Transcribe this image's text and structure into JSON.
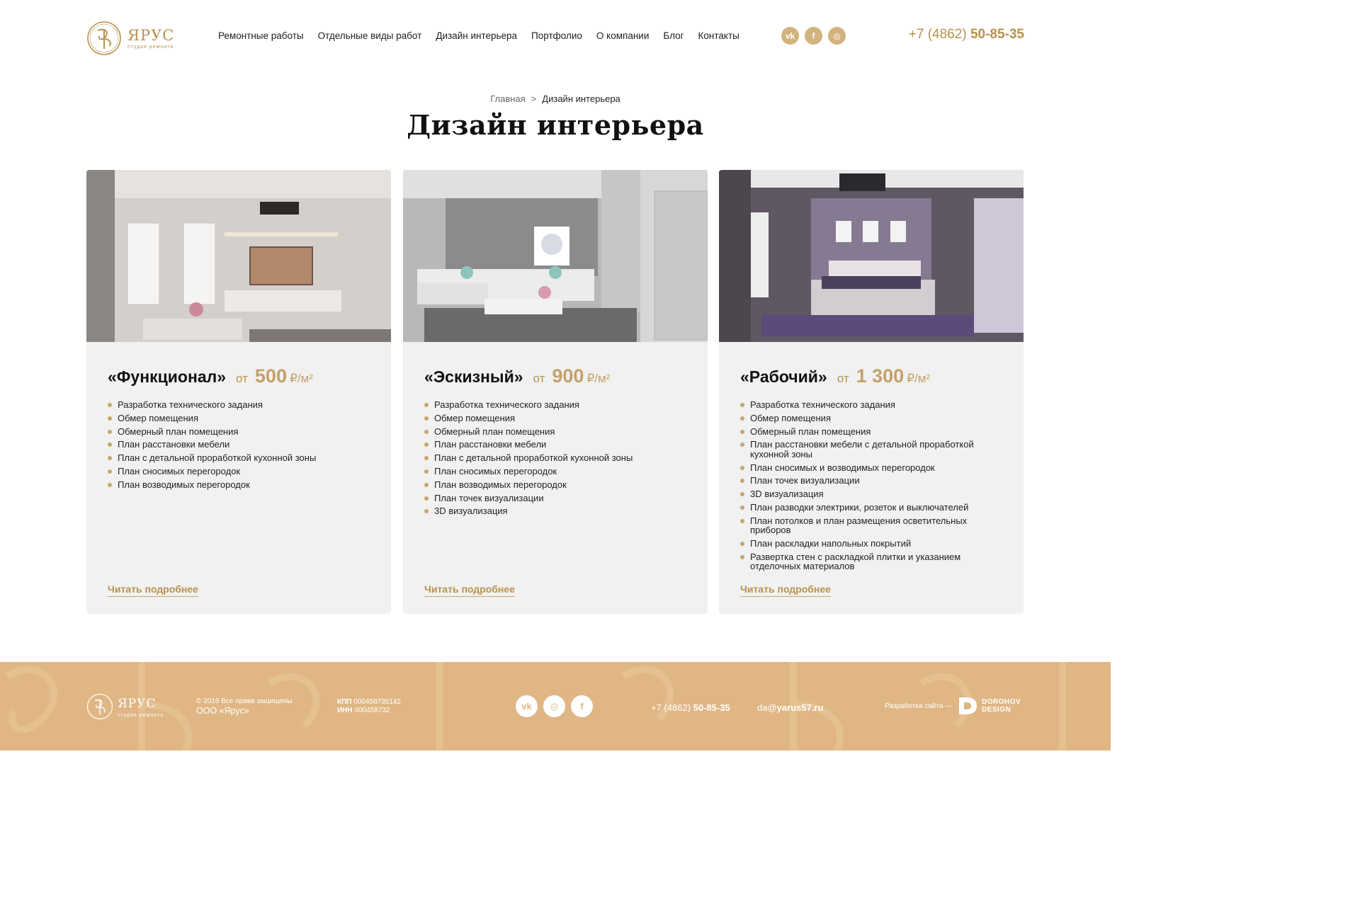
{
  "header": {
    "logo": {
      "name": "ЯРУС",
      "sub": "студия ремонта"
    },
    "nav": [
      {
        "label": "Ремонтные работы"
      },
      {
        "label": "Отдельные виды работ"
      },
      {
        "label": "Дизайн интерьера"
      },
      {
        "label": "Портфолио"
      },
      {
        "label": "О компании"
      },
      {
        "label": "Блог"
      },
      {
        "label": "Контакты"
      }
    ],
    "socials": [
      {
        "icon": "vk-icon",
        "glyph": "vk"
      },
      {
        "icon": "facebook-icon",
        "glyph": "f"
      },
      {
        "icon": "instagram-icon",
        "glyph": "◎"
      }
    ],
    "phone": {
      "prefix": "+7 (4862) ",
      "number": "50-85-35"
    }
  },
  "breadcrumb": {
    "home": "Главная",
    "separator": ">",
    "current": "Дизайн интерьера"
  },
  "title": "Дизайн интерьера",
  "cards": [
    {
      "name": "«Функционал»",
      "from": "от",
      "price": "500",
      "unit": "₽/м²",
      "items": [
        "Разработка технического задания",
        "Обмер помещения",
        "Обмерный план помещения",
        "План расстановки мебели",
        "План с детальной проработкой кухонной зоны",
        "План сносимых перегородок",
        "План возводимых перегородок"
      ],
      "more": "Читать подробнее"
    },
    {
      "name": "«Эскизный»",
      "from": "от",
      "price": "900",
      "unit": "₽/м²",
      "items": [
        "Разработка технического задания",
        "Обмер помещения",
        "Обмерный план помещения",
        "План расстановки мебели",
        "План с детальной проработкой кухонной зоны",
        "План сносимых перегородок",
        "План возводимых перегородок",
        "План точек визуализации",
        "3D визуализация"
      ],
      "more": "Читать подробнее"
    },
    {
      "name": "«Рабочий»",
      "from": "от",
      "price": "1 300",
      "unit": "₽/м²",
      "items": [
        "Разработка технического задания",
        "Обмер помещения",
        "Обмерный план помещения",
        "План расстановки мебели с детальной проработкой кухонной зоны",
        "План сносимых и возводимых перегородок",
        "План точек визуализации",
        "3D визуализация",
        "План разводки электрики, розеток и выключателей",
        "План потолков и план размещения осветительных приборов",
        "План раскладки напольных покрытий",
        "Развертка стен с раскладкой плитки и указанием отделочных материалов"
      ],
      "more": "Читать подробнее"
    }
  ],
  "footer": {
    "logo": {
      "name": "ЯРУС",
      "sub": "студия ремонта"
    },
    "copyright": "© 2016 Все права защищены",
    "org": "ООО «Ярус»",
    "kpp_label": "КПП",
    "kpp": "000458735142",
    "inn_label": "ИНН",
    "inn": "000458732",
    "socials": [
      {
        "icon": "vk-icon",
        "glyph": "vk"
      },
      {
        "icon": "instagram-icon",
        "glyph": "◎"
      },
      {
        "icon": "facebook-icon",
        "glyph": "f"
      }
    ],
    "phone": {
      "prefix": "+7 (4862) ",
      "number": "50-85-35"
    },
    "email": {
      "user": "da@",
      "domain": "yarus57.ru"
    },
    "developer_label": "Разработка сайта —",
    "developer": {
      "line1": "DOROHOV",
      "line2": "DESIGN"
    }
  },
  "colors": {
    "accent": "#b8924e",
    "accent_light": "#c9a56d",
    "card_bg": "#f1f1f1",
    "footer_bg": "#dfb684"
  }
}
